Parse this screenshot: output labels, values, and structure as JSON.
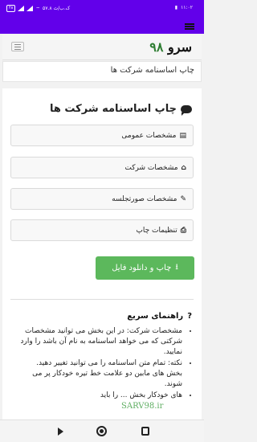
{
  "status": {
    "time": "۱۱:۰۲",
    "battery": "۴۸",
    "speed": "۵۷.۸ ک.ب/ث"
  },
  "header": {
    "logo_text": "سرو",
    "logo_number": "۹۸"
  },
  "breadcrumb": {
    "text": "چاپ اساسنامه شرکت ها"
  },
  "page": {
    "title": "چاپ اساسنامه شرکت ها",
    "title_icon": "comment-icon"
  },
  "sections": [
    {
      "label": "مشخصات عمومی",
      "icon": "book-icon"
    },
    {
      "label": "مشخصات شرکت",
      "icon": "home-icon"
    },
    {
      "label": "مشخصات صورتجلسه",
      "icon": "edit-icon"
    },
    {
      "label": "تنظیمات چاپ",
      "icon": "print-icon"
    }
  ],
  "download_button": {
    "label": "چاپ و دانلود فایل",
    "icon": "download-icon",
    "color": "#5cb85c"
  },
  "guide": {
    "title": "راهنمای سریع",
    "icon": "question-icon",
    "items": [
      "مشخصات شرکت: در این بخش می توانید مشخصات شرکتی که می خواهد اساسنامه به نام آن باشد را وارد نمایید.",
      "نکته: تمام متن اساسنامه را می توانید تغییر دهید. بخش های مابین دو علامت خط تیره خودکار پر می شوند.",
      "های خودکار بخش ... را باید"
    ]
  },
  "watermark": "SARV98.ir",
  "colors": {
    "statusbar": "#6200ea",
    "logo_number": "#2e7d32"
  }
}
